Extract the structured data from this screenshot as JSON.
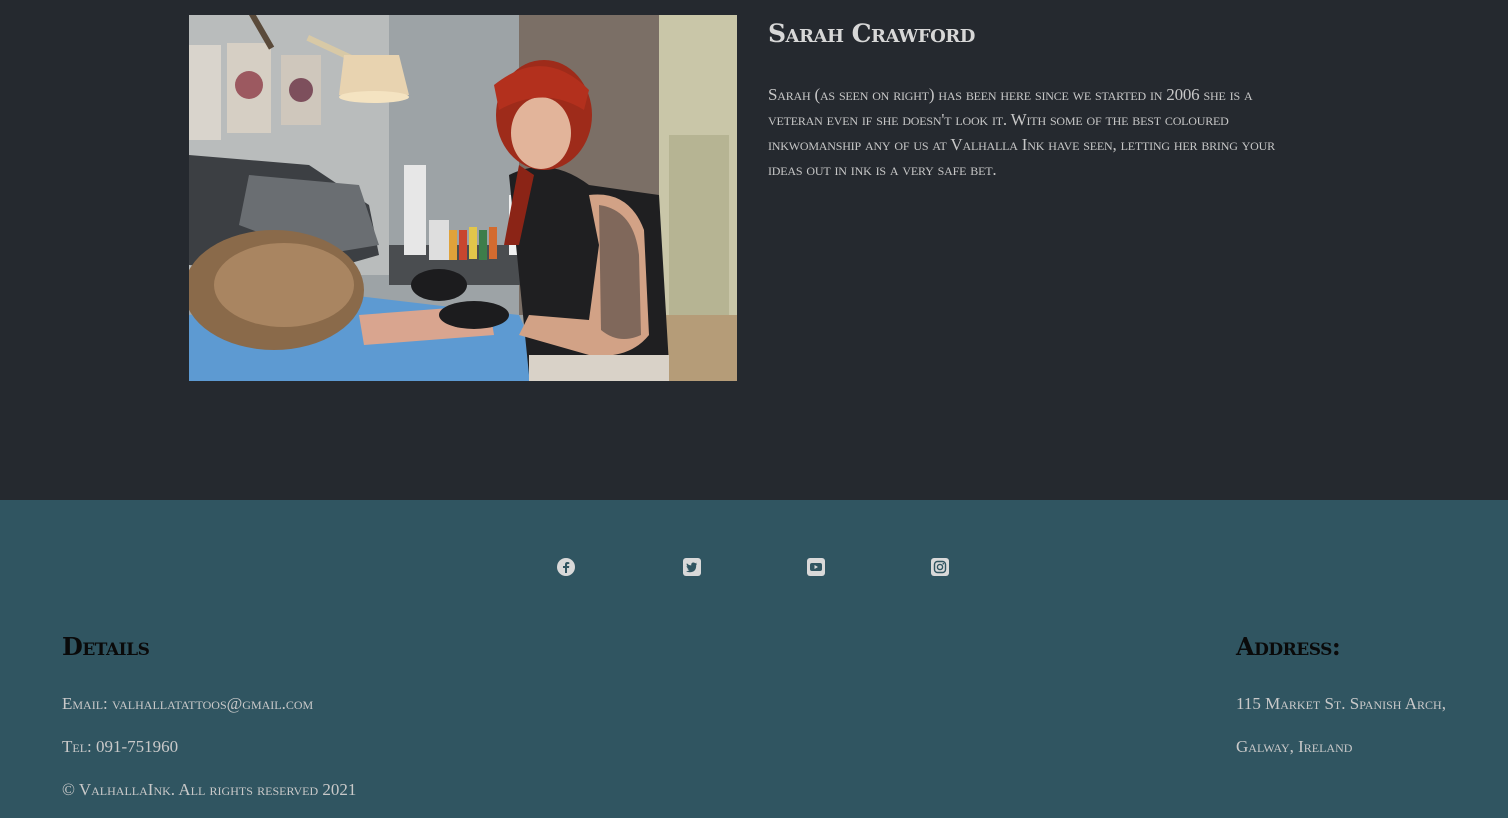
{
  "artist": {
    "name": "Sarah Crawford",
    "bio": "Sarah (as seen on right) has been here since we started in 2006 she is a veteran even if she doesn't look it. With some of the best coloured inkwomanship any of us at Valhalla Ink have seen, letting her bring your ideas out in ink is a very safe bet.",
    "photo_icon": "tattoo-artist-photo"
  },
  "social": [
    {
      "name": "facebook",
      "icon": "facebook-icon"
    },
    {
      "name": "twitter",
      "icon": "twitter-icon"
    },
    {
      "name": "youtube",
      "icon": "youtube-icon"
    },
    {
      "name": "instagram",
      "icon": "instagram-icon"
    }
  ],
  "footer": {
    "details_heading": "Details",
    "email": "Email: valhallatattoos@gmail.com",
    "tel": "Tel: 091-751960",
    "copyright": "© ValhallaInk. All rights reserved 2021",
    "address_heading": "Address:",
    "address_line1": "115 Market St. Spanish Arch,",
    "address_line2": "Galway, Ireland"
  },
  "colors": {
    "page_bg": "#25292f",
    "footer_bg": "#305561",
    "text": "#c9c9c9",
    "heading_dark": "#0a0a0a"
  }
}
